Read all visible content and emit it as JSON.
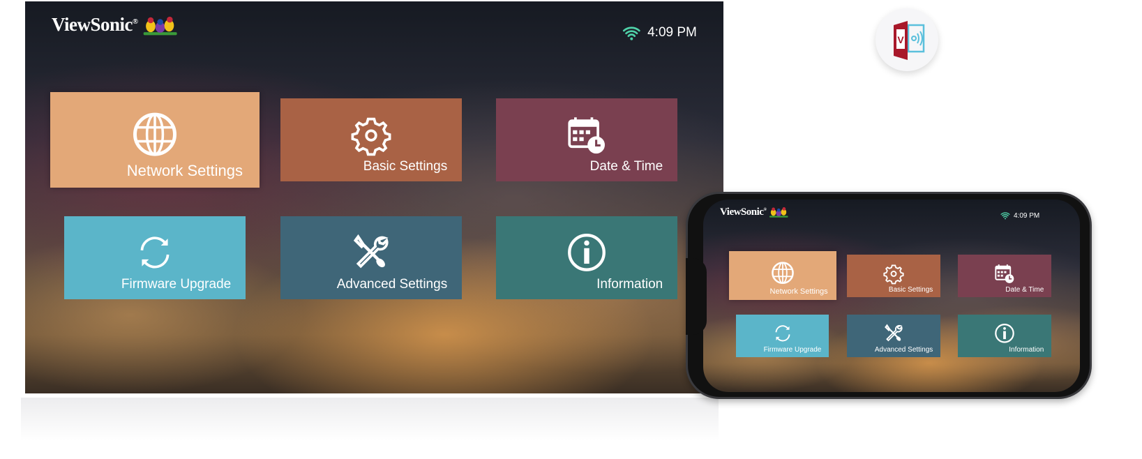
{
  "brand": {
    "logo_text": "ViewSonic"
  },
  "status": {
    "time": "4:09 PM",
    "wifi_icon": "wifi-icon",
    "wifi_color": "#4fd1a8"
  },
  "menu": [
    {
      "label": "Network Settings",
      "icon": "globe-icon",
      "color": "#e3a878"
    },
    {
      "label": "Basic Settings",
      "icon": "gear-icon",
      "color": "#a96245"
    },
    {
      "label": "Date & Time",
      "icon": "calendar-clock-icon",
      "color": "#7a4050"
    },
    {
      "label": "Firmware Upgrade",
      "icon": "refresh-icon",
      "color": "#5bb5c9"
    },
    {
      "label": "Advanced Settings",
      "icon": "tools-icon",
      "color": "#3f6678"
    },
    {
      "label": "Information",
      "icon": "info-icon",
      "color": "#3a7776"
    }
  ],
  "cast_icon": "screen-cast-app-icon"
}
